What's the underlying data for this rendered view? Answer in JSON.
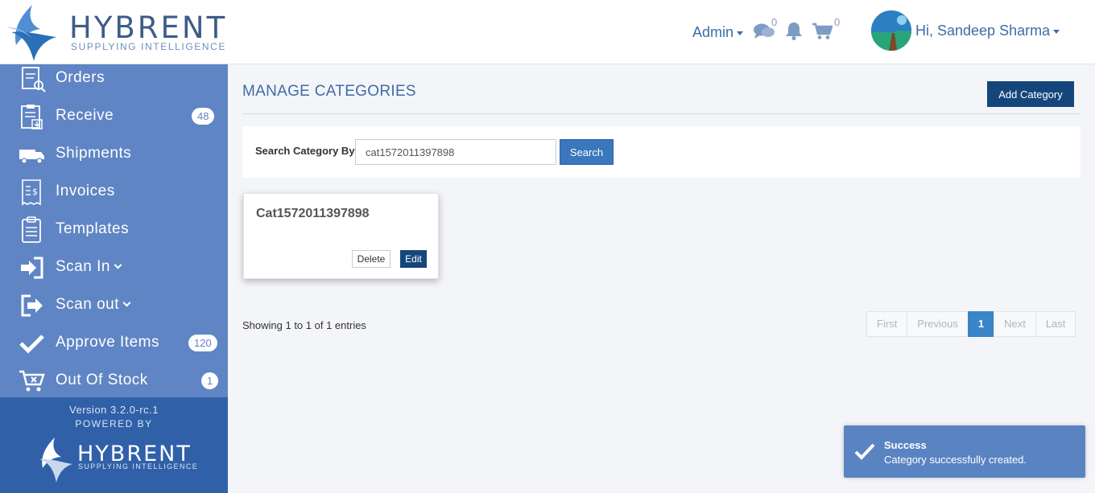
{
  "header": {
    "logo_text": "HYBRENT",
    "logo_subtitle": "SUPPLYING INTELLIGENCE",
    "admin_label": "Admin",
    "messages_count": "0",
    "cart_count": "0",
    "greeting": "Hi, Sandeep Sharma"
  },
  "sidebar": {
    "items": [
      {
        "label": "Orders",
        "icon": "orders-icon"
      },
      {
        "label": "Receive",
        "icon": "receive-icon",
        "badge": "48"
      },
      {
        "label": "Shipments",
        "icon": "truck-icon"
      },
      {
        "label": "Invoices",
        "icon": "invoice-icon"
      },
      {
        "label": "Templates",
        "icon": "clipboard-icon"
      },
      {
        "label": "Scan In",
        "icon": "sign-in-icon"
      },
      {
        "label": "Scan out",
        "icon": "sign-out-icon"
      },
      {
        "label": "Approve Items",
        "icon": "check-icon",
        "badge": "120"
      },
      {
        "label": "Out Of Stock",
        "icon": "cart-icon",
        "badge": "1"
      }
    ],
    "version": "Version 3.2.0-rc.1",
    "powered_by": "POWERED BY",
    "footer_logo_text": "HYBRENT",
    "footer_logo_subtitle": "SUPPLYING INTELLIGENCE"
  },
  "main": {
    "title": "MANAGE CATEGORIES",
    "add_button": "Add Category",
    "search_label": "Search Category By",
    "search_value": "cat1572011397898",
    "search_button": "Search",
    "card_title": "Cat1572011397898",
    "delete_button": "Delete",
    "edit_button": "Edit",
    "showing_text": "Showing 1 to 1 of 1 entries",
    "pagination": [
      "First",
      "Previous",
      "1",
      "Next",
      "Last"
    ]
  },
  "toast": {
    "title": "Success",
    "message": "Category successfully created."
  },
  "colors": {
    "sidebar": "#5f85c4",
    "sidebar_footer": "#3060a8",
    "primary_dark": "#15467b",
    "toast": "#5a83c2"
  }
}
